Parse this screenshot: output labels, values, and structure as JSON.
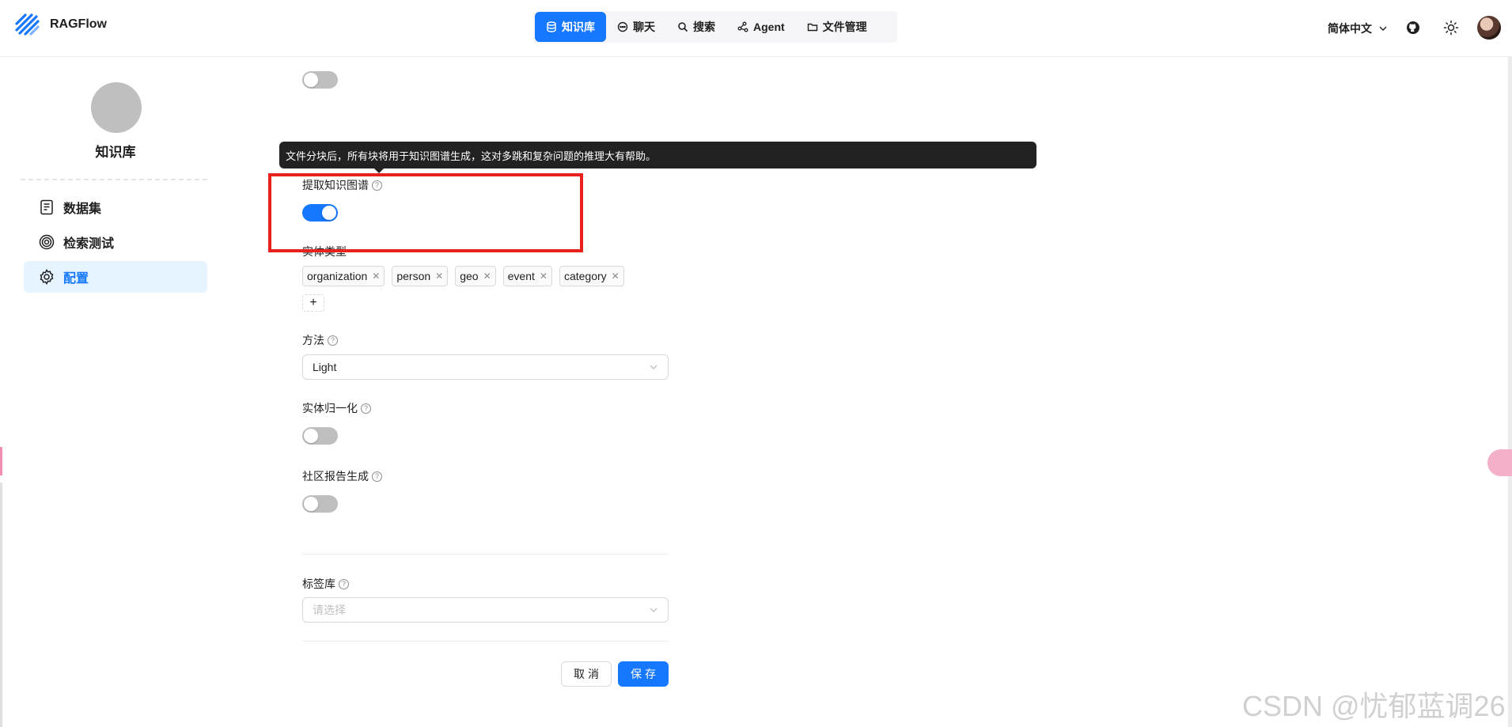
{
  "app": {
    "brand": "RAGFlow"
  },
  "nav": {
    "items": [
      {
        "label": "知识库",
        "icon": "database-icon",
        "active": true
      },
      {
        "label": "聊天",
        "icon": "chat-icon",
        "active": false
      },
      {
        "label": "搜索",
        "icon": "search-icon",
        "active": false
      },
      {
        "label": "Agent",
        "icon": "agent-icon",
        "active": false
      },
      {
        "label": "文件管理",
        "icon": "folder-icon",
        "active": false
      }
    ]
  },
  "header_right": {
    "language": "简体中文"
  },
  "sidebar": {
    "kb_name": "知识库",
    "items": [
      {
        "label": "数据集",
        "icon": "document-icon",
        "active": false
      },
      {
        "label": "检索测试",
        "icon": "target-icon",
        "active": false
      },
      {
        "label": "配置",
        "icon": "gear-icon",
        "active": true
      }
    ]
  },
  "form": {
    "top_toggle_on": false,
    "tooltip": "文件分块后，所有块将用于知识图谱生成，这对多跳和复杂问题的推理大有帮助。",
    "kg_label": "提取知识图谱",
    "kg_on": true,
    "entity_types_label": "实体类型",
    "entity_types": [
      "organization",
      "person",
      "geo",
      "event",
      "category"
    ],
    "add_tag": "+",
    "method_label": "方法",
    "method_value": "Light",
    "entity_resolution_label": "实体归一化",
    "entity_resolution_on": false,
    "community_label": "社区报告生成",
    "community_on": false,
    "tag_kb_label": "标签库",
    "tag_kb_placeholder": "请选择",
    "cancel": "取消",
    "save": "保存"
  },
  "watermark": "CSDN @忧郁蓝调26",
  "colors": {
    "primary": "#1677ff",
    "highlight": "#e8211d"
  }
}
